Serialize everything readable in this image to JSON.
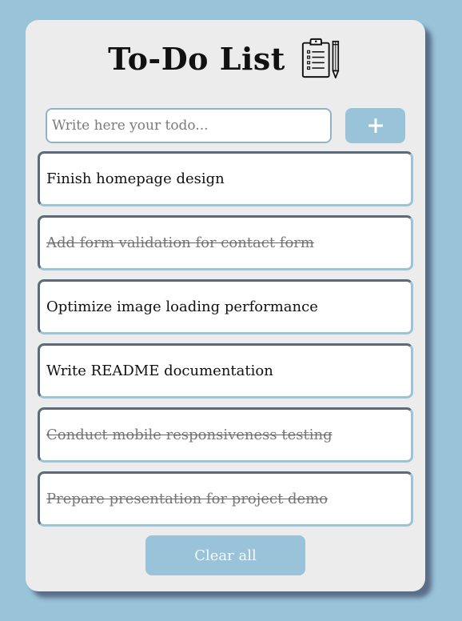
{
  "app": {
    "title": "To-Do List",
    "icon": "clipboard-pencil-icon"
  },
  "input": {
    "placeholder": "Write here your todo...",
    "value": ""
  },
  "add_button": {
    "icon": "plus-icon"
  },
  "todos": [
    {
      "text": "Finish homepage design",
      "completed": false
    },
    {
      "text": "Add form validation for contact form",
      "completed": true
    },
    {
      "text": "Optimize image loading performance",
      "completed": false
    },
    {
      "text": "Write README documentation",
      "completed": false
    },
    {
      "text": "Conduct mobile responsiveness testing",
      "completed": true
    },
    {
      "text": "Prepare presentation for project demo",
      "completed": true
    }
  ],
  "clear_button": {
    "label": "Clear all"
  },
  "colors": {
    "background": "#98c3d9",
    "card": "#ececec",
    "accent": "#98c3d9",
    "item_border_dark": "#5a6b7b",
    "completed_text": "#777777"
  }
}
